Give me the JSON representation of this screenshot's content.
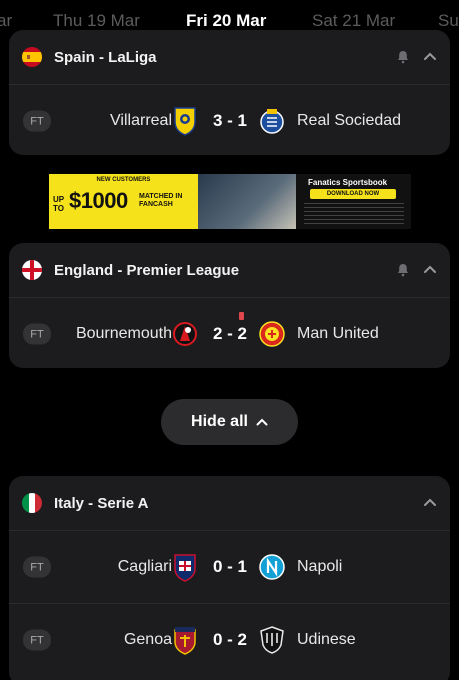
{
  "dates": [
    {
      "label": "Thu 19 Mar",
      "active": false
    },
    {
      "label": "Fri 20 Mar",
      "active": true
    },
    {
      "label": "Sat 21 Mar",
      "active": false
    },
    {
      "label": "Sun",
      "active": false
    }
  ],
  "leagues": [
    {
      "name": "Spain - LaLiga",
      "flag": "spain-flag-icon",
      "notifications": true,
      "matches": [
        {
          "status": "FT",
          "home": "Villarreal",
          "score": "3 - 1",
          "away": "Real Sociedad",
          "home_crest": "villarreal-crest-icon",
          "away_crest": "real-sociedad-crest-icon"
        }
      ]
    },
    {
      "name": "England - Premier League",
      "flag": "england-flag-icon",
      "notifications": true,
      "matches": [
        {
          "status": "FT",
          "home": "Bournemouth",
          "score": "2 - 2",
          "away": "Man United",
          "home_crest": "bournemouth-crest-icon",
          "away_crest": "man-united-crest-icon",
          "red_card": true
        }
      ]
    },
    {
      "name": "Italy - Serie A",
      "flag": "italy-flag-icon",
      "notifications": false,
      "matches": [
        {
          "status": "FT",
          "home": "Cagliari",
          "score": "0 - 1",
          "away": "Napoli",
          "home_crest": "cagliari-crest-icon",
          "away_crest": "napoli-crest-icon"
        },
        {
          "status": "FT",
          "home": "Genoa",
          "score": "0 - 2",
          "away": "Udinese",
          "home_crest": "genoa-crest-icon",
          "away_crest": "udinese-crest-icon"
        }
      ]
    }
  ],
  "ad": {
    "headline": "NEW CUSTOMERS",
    "up_to": "UP TO",
    "amount": "$1000",
    "matched": "MATCHED IN FANCASH",
    "brand": "Fanatics Sportsbook",
    "cta": "DOWNLOAD NOW"
  },
  "hide_all_label": "Hide all",
  "colors": {
    "background": "#000000",
    "card": "#1c1c1e",
    "accent_yellow": "#f5e21b",
    "red_card": "#e0474c"
  }
}
